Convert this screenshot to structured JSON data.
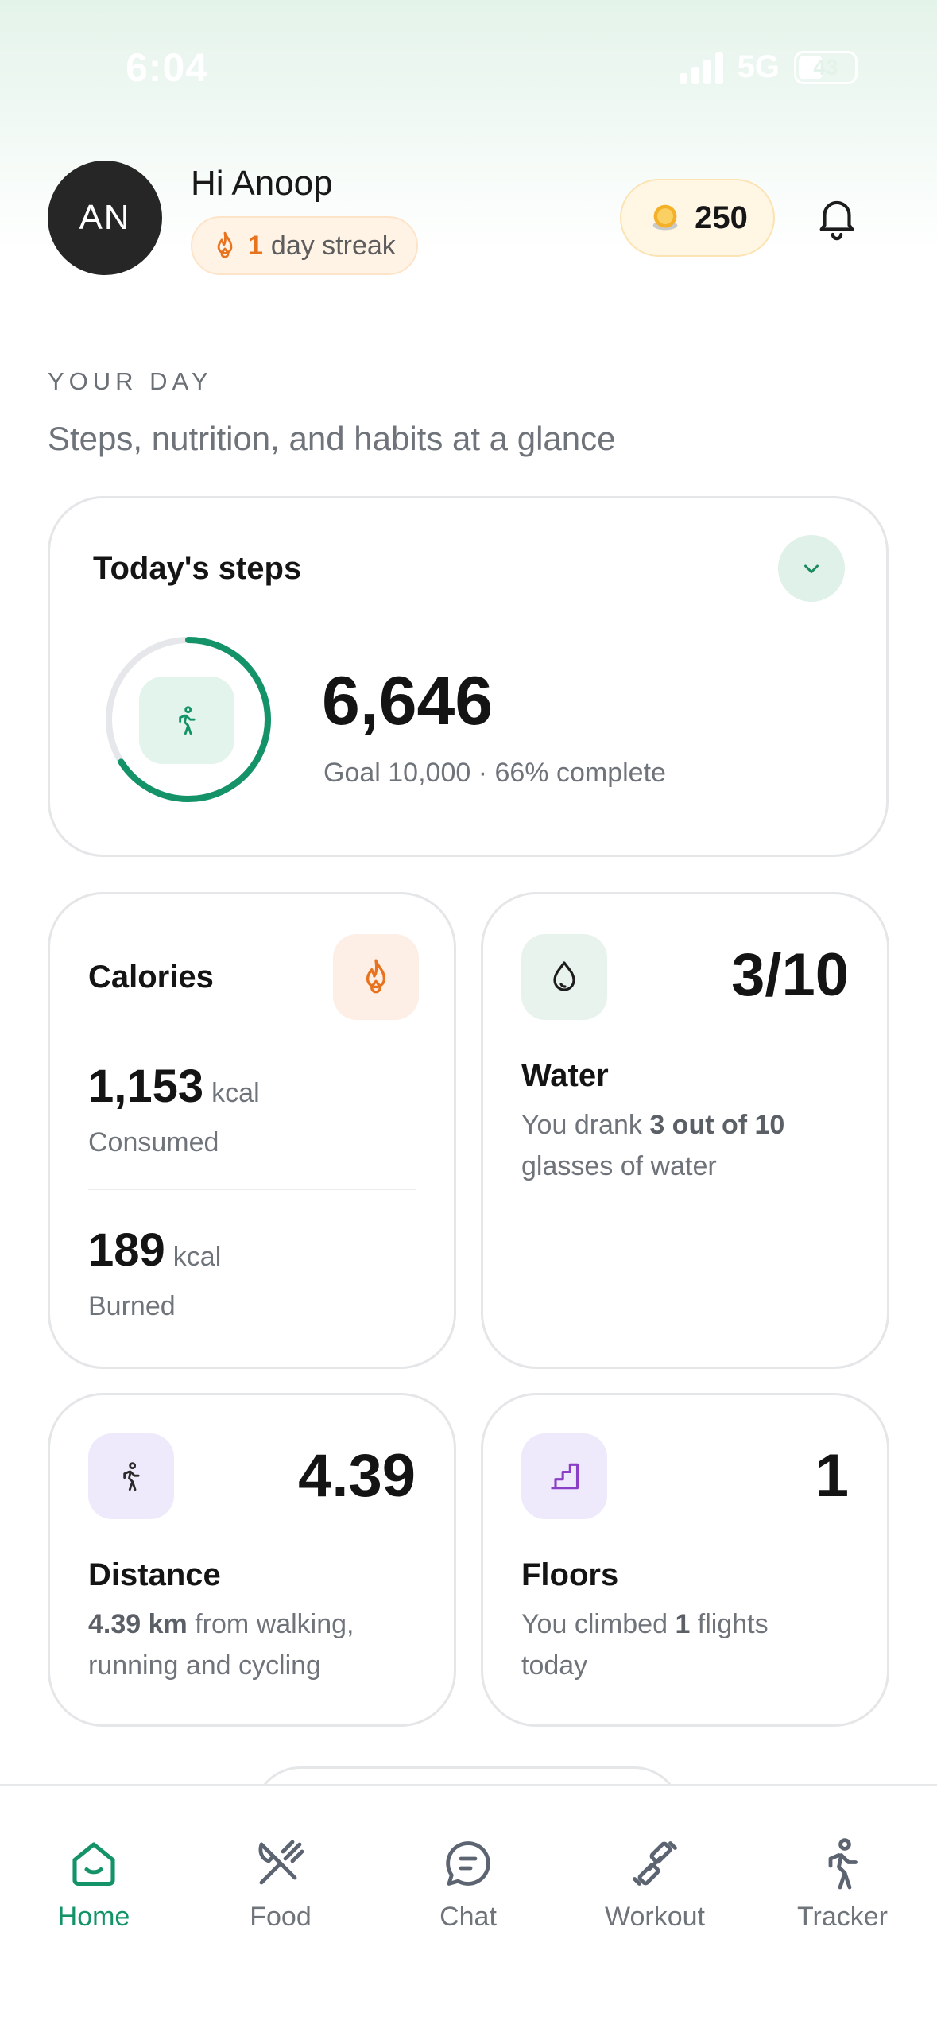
{
  "status": {
    "time": "6:04",
    "network": "5G",
    "battery": "43"
  },
  "header": {
    "avatar_initials": "AN",
    "greeting": "Hi Anoop",
    "streak_count": "1",
    "streak_label": "day streak",
    "coins": "250"
  },
  "section": {
    "label": "YOUR DAY",
    "subtitle": "Steps, nutrition, and habits at a glance"
  },
  "steps": {
    "title": "Today's steps",
    "value": "6,646",
    "goal_text": "Goal 10,000 · 66% complete",
    "progress_fraction": 0.66
  },
  "calories": {
    "title": "Calories",
    "consumed_value": "1,153",
    "consumed_unit": "kcal",
    "consumed_label": "Consumed",
    "burned_value": "189",
    "burned_unit": "kcal",
    "burned_label": "Burned"
  },
  "water": {
    "value": "3/10",
    "title": "Water",
    "desc_prefix": "You drank ",
    "desc_bold": "3 out of 10",
    "desc_suffix": " glasses of water"
  },
  "distance": {
    "value": "4.39",
    "title": "Distance",
    "desc_bold": "4.39 km",
    "desc_suffix": " from walking, running and cycling"
  },
  "floors": {
    "value": "1",
    "title": "Floors",
    "desc_prefix": "You climbed ",
    "desc_bold": "1",
    "desc_suffix": " flights today"
  },
  "tabs": [
    {
      "label": "Home",
      "icon": "home-icon",
      "active": true
    },
    {
      "label": "Food",
      "icon": "fork-knife-icon",
      "active": false
    },
    {
      "label": "Chat",
      "icon": "chat-icon",
      "active": false
    },
    {
      "label": "Workout",
      "icon": "dumbbell-icon",
      "active": false
    },
    {
      "label": "Tracker",
      "icon": "walking-icon",
      "active": false
    }
  ],
  "colors": {
    "accent": "#139367",
    "streak": "#e8731e",
    "calorie_tile": "#fdeee6",
    "water_tile": "#e9f3ee",
    "purple_tile": "#efeafb"
  }
}
